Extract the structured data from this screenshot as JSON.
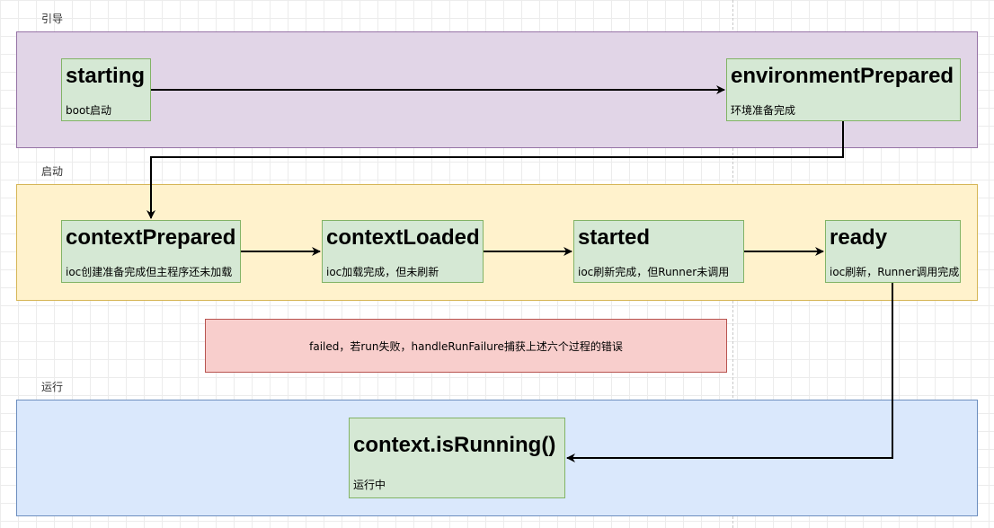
{
  "lanes": {
    "boot": {
      "label": "引导",
      "fill": "#e1d5e7",
      "stroke": "#9673a6"
    },
    "start": {
      "label": "启动",
      "fill": "#fff2cc",
      "stroke": "#d6b656"
    },
    "running": {
      "label": "运行",
      "fill": "#dae8fc",
      "stroke": "#6c8ebf"
    }
  },
  "nodes": {
    "starting": {
      "title": "starting",
      "desc": "boot启动"
    },
    "environment_prepared": {
      "title": "environmentPrepared",
      "desc": "环境准备完成"
    },
    "context_prepared": {
      "title": "contextPrepared",
      "desc": "ioc创建准备完成但主程序还未加载"
    },
    "context_loaded": {
      "title": "contextLoaded",
      "desc": "ioc加载完成，但未刷新"
    },
    "started": {
      "title": "started",
      "desc": "ioc刷新完成，但Runner未调用"
    },
    "ready": {
      "title": "ready",
      "desc": "ioc刷新，Runner调用完成"
    },
    "context_running": {
      "title": "context.isRunning()",
      "desc": "运行中"
    }
  },
  "failed": {
    "text": "failed，若run失败，handleRunFailure捕获上述六个过程的错误",
    "fill": "#f8cecc",
    "stroke": "#b85450"
  },
  "node_style": {
    "fill": "#d5e8d4",
    "stroke": "#82b366"
  }
}
